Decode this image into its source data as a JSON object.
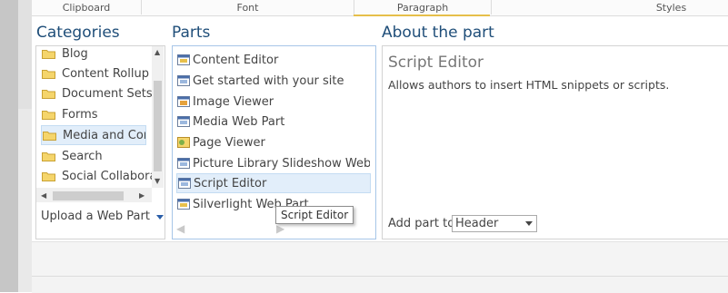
{
  "ribbon": {
    "groups": [
      {
        "label": "Clipboard"
      },
      {
        "label": "Font"
      },
      {
        "label": "Paragraph"
      },
      {
        "label": "Styles"
      }
    ]
  },
  "categories": {
    "heading": "Categories",
    "items": [
      {
        "label": "Blog"
      },
      {
        "label": "Content Rollup"
      },
      {
        "label": "Document Sets"
      },
      {
        "label": "Forms"
      },
      {
        "label": "Media and Content"
      },
      {
        "label": "Search"
      },
      {
        "label": "Social Collaboration"
      }
    ],
    "selected": "Media and Content",
    "upload_label": "Upload a Web Part"
  },
  "parts": {
    "heading": "Parts",
    "items": [
      {
        "label": "Content Editor",
        "icon": "content-editor-icon"
      },
      {
        "label": "Get started with your site",
        "icon": "webpart-icon"
      },
      {
        "label": "Image Viewer",
        "icon": "image-viewer-icon"
      },
      {
        "label": "Media Web Part",
        "icon": "webpart-icon"
      },
      {
        "label": "Page Viewer",
        "icon": "page-viewer-icon"
      },
      {
        "label": "Picture Library Slideshow Web Part",
        "icon": "webpart-icon"
      },
      {
        "label": "Script Editor",
        "icon": "webpart-icon"
      },
      {
        "label": "Silverlight Web Part",
        "icon": "content-editor-icon"
      }
    ],
    "selected": "Script Editor",
    "tooltip": "Script Editor"
  },
  "about": {
    "heading": "About the part",
    "title": "Script Editor",
    "description": "Allows authors to insert HTML snippets or scripts.",
    "add_part_label": "Add part to:",
    "add_part_value": "Header"
  },
  "colors": {
    "heading": "#1f4e79",
    "selection": "#e2eefa",
    "accent_tab": "#e6bf4a"
  }
}
